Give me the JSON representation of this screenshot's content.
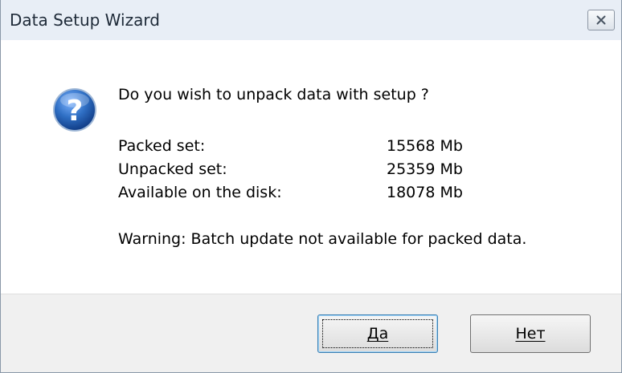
{
  "window": {
    "title": "Data Setup Wizard",
    "close_icon": "close-icon"
  },
  "dialog": {
    "icon": "question-icon",
    "message": "Do you wish to unpack data with setup ?",
    "rows": [
      {
        "label": "Packed set:",
        "value": "15568 Mb"
      },
      {
        "label": "Unpacked set:",
        "value": "25359 Mb"
      },
      {
        "label": "Available on the disk:",
        "value": "18078 Mb"
      }
    ],
    "warning": "Warning: Batch update not available for packed data."
  },
  "buttons": {
    "yes_label": "Да",
    "no_label": "Нет"
  },
  "colors": {
    "titlebar_bg": "#e8eef6",
    "footer_bg": "#f0f0f0",
    "icon_blue": "#2f6fc4"
  }
}
